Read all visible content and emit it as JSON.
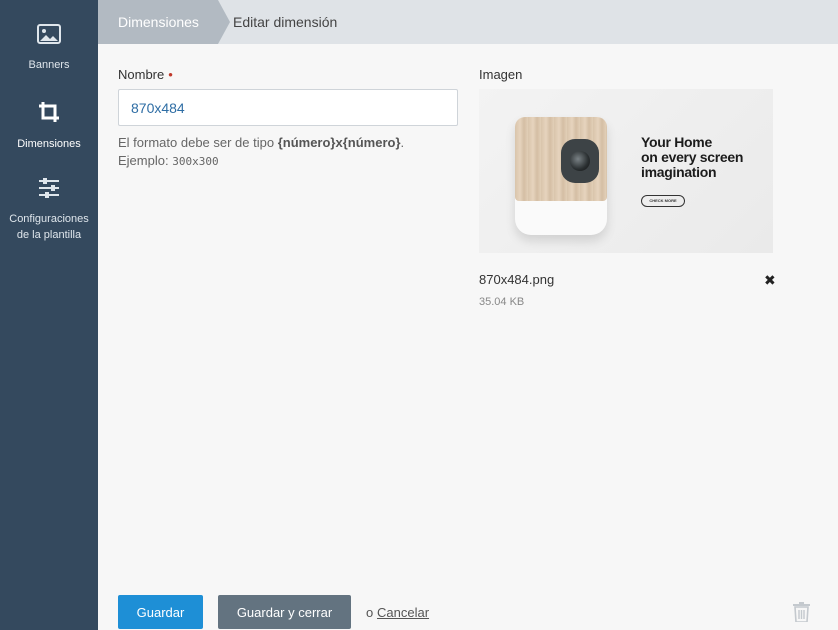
{
  "sidebar": {
    "items": [
      {
        "label": "Banners",
        "icon": "image-icon",
        "active": false
      },
      {
        "label": "Dimensiones",
        "icon": "crop-icon",
        "active": true
      },
      {
        "label_line1": "Configuraciones",
        "label_line2": "de la plantilla",
        "icon": "sliders-icon",
        "active": false
      }
    ]
  },
  "breadcrumb": {
    "first": "Dimensiones",
    "second": "Editar dimensión"
  },
  "form": {
    "name_label": "Nombre",
    "required_mark": "•",
    "name_value": "870x484",
    "hint_prefix": "El formato debe ser de tipo ",
    "hint_format": "{número}x{número}",
    "hint_suffix": ".",
    "example_label": "Ejemplo: ",
    "example_value": "300x300",
    "image_label": "Imagen"
  },
  "image": {
    "headline_line1": "Your Home",
    "headline_line2": "on every screen",
    "headline_line3": "imagination",
    "cta": "CHECK MORE",
    "file_name": "870x484.png",
    "file_size": "35.04 KB"
  },
  "footer": {
    "save_label": "Guardar",
    "save_close_label": "Guardar y cerrar",
    "or_text": "o",
    "cancel_label": "Cancelar"
  },
  "colors": {
    "sidebar_bg": "#34495e",
    "primary": "#1e8fd6",
    "secondary": "#637380",
    "required": "#c0392b"
  }
}
